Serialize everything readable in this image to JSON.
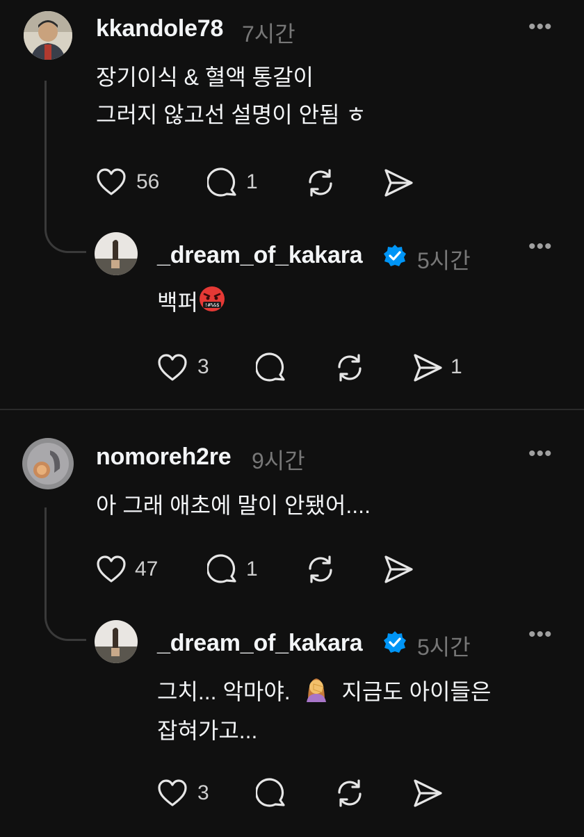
{
  "threads": [
    {
      "comment": {
        "username": "kkandole78",
        "time": "7시간",
        "lines": [
          "장기이식 & 혈액 통갈이",
          "그러지 않고선 설명이 안됨 ㅎ"
        ],
        "likes": "56",
        "replies": "1",
        "more": "•••"
      },
      "reply": {
        "username": "_dream_of_kakara",
        "time": "5시간",
        "lines": [
          "백퍼"
        ],
        "emoji": "angry-swearing-face",
        "likes": "3",
        "shares": "1",
        "more": "•••"
      }
    },
    {
      "comment": {
        "username": "nomoreh2re",
        "time": "9시간",
        "lines": [
          "아 그래 애초에 말이 안됐어...."
        ],
        "likes": "47",
        "replies": "1",
        "more": "•••"
      },
      "reply": {
        "username": "_dream_of_kakara",
        "time": "5시간",
        "line1_a": "그치... 악마야.",
        "line1_b": "지금도 아이들은",
        "line2": "잡혀가고...",
        "emoji": "facepalm-woman",
        "likes": "3",
        "more": "•••"
      }
    }
  ],
  "colors": {
    "background": "#101010",
    "verified_blue": "#0095f6",
    "secondary_text": "#777777"
  }
}
